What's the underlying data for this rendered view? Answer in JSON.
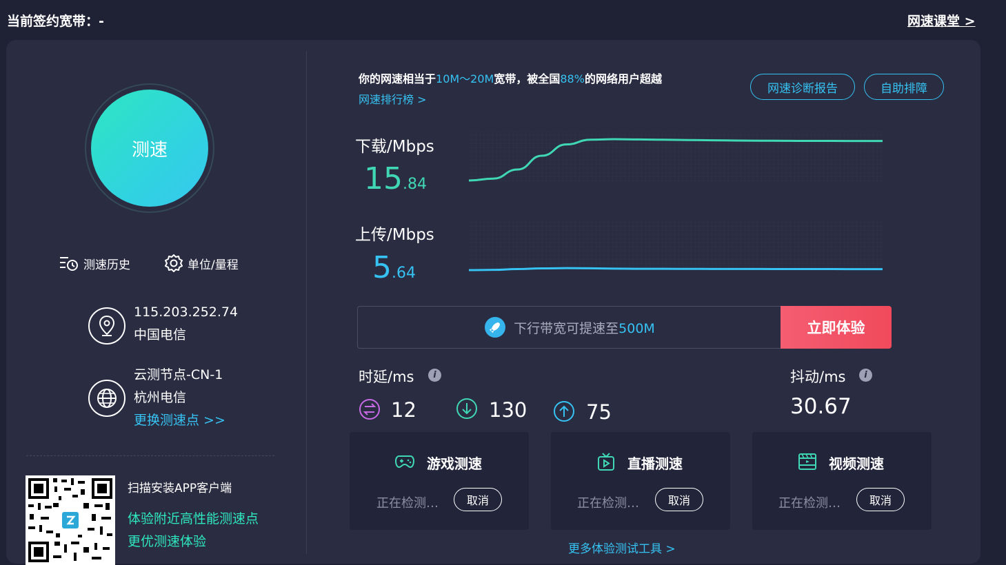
{
  "topbar": {
    "contract_label": "当前签约宽带：-",
    "course_link": "网速课堂 >"
  },
  "left": {
    "test_button": "测速",
    "history_label": "测速历史",
    "unit_label": "单位/量程",
    "ip": "115.203.252.74",
    "isp": "中国电信",
    "node_name": "云测节点-CN-1",
    "node_isp": "杭州电信",
    "change_node": "更换测速点 >>",
    "qr_title": "扫描安装APP客户端",
    "qr_line1": "体验附近高性能测速点",
    "qr_line2": "更优测速体验"
  },
  "summary": {
    "prefix": "你的网速相当于",
    "bandwidth": "10M～20M",
    "middle": "宽带，被全国",
    "percent": "88%",
    "suffix": "的网络用户超越",
    "ranking_link": "网速排行榜 >",
    "report_button": "网速诊断报告",
    "troubleshoot_button": "自助排障"
  },
  "download": {
    "label": "下载/Mbps",
    "int": "15",
    "dec": ".84",
    "color": "#40d8b4"
  },
  "upload": {
    "label": "上传/Mbps",
    "int": "5",
    "dec": ".64",
    "color": "#36c2f2"
  },
  "promo": {
    "text_prefix": "下行带宽可提速至",
    "text_value": "500M",
    "button": "立即体验"
  },
  "latency": {
    "label": "时延/ms",
    "ping": "12",
    "down": "130",
    "up": "75",
    "ping_icon": "swap-icon",
    "down_icon": "arrow-down-circle-icon",
    "up_icon": "arrow-up-circle-icon"
  },
  "jitter": {
    "label": "抖动/ms",
    "value": "30.67"
  },
  "cards": [
    {
      "title": "游戏测速",
      "status": "正在检测…",
      "cancel": "取消",
      "icon": "gamepad-icon"
    },
    {
      "title": "直播测速",
      "status": "正在检测…",
      "cancel": "取消",
      "icon": "tv-icon"
    },
    {
      "title": "视频测速",
      "status": "正在检测…",
      "cancel": "取消",
      "icon": "film-icon"
    }
  ],
  "more_tools": "更多体验测试工具 >",
  "chart_data": {
    "type": "line",
    "series": [
      {
        "name": "下载/Mbps",
        "values": [
          1.5,
          2.2,
          5.5,
          10.5,
          14.6,
          16.3,
          16.5,
          16.4,
          16.3,
          16.2,
          16.1,
          16.0,
          15.95,
          15.9,
          15.88,
          15.86,
          15.85,
          15.84
        ]
      },
      {
        "name": "上传/Mbps",
        "values": [
          4.8,
          5.0,
          5.7,
          6.3,
          6.5,
          6.4,
          6.1,
          5.95,
          5.9,
          5.85,
          5.8,
          5.77,
          5.74,
          5.71,
          5.69,
          5.67,
          5.65,
          5.64
        ]
      }
    ]
  }
}
